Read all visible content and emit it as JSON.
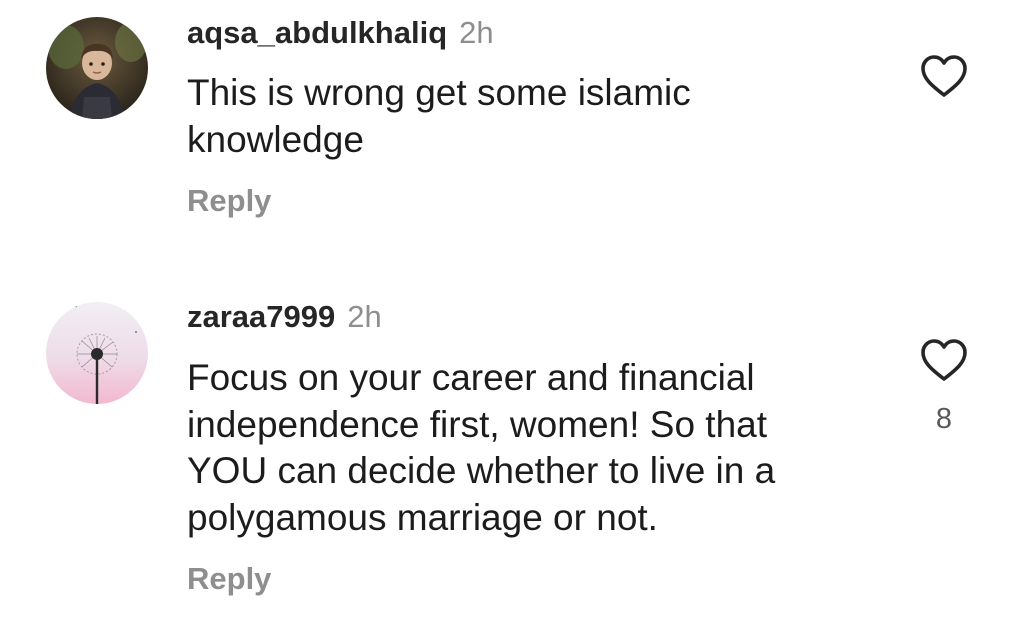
{
  "comments": [
    {
      "username": "aqsa_abdulkhaliq",
      "time": "2h",
      "text_lines": [
        "This is wrong get some islamic",
        "knowledge"
      ],
      "reply_label": "Reply",
      "avatar_icon": "child-photo-avatar",
      "like_icon": "heart-outline-icon",
      "like_count": ""
    },
    {
      "username": "zaraa7999",
      "time": "2h",
      "text_lines": [
        "Focus on your career and financial",
        "independence first, women! So that",
        "YOU can decide whether to live in a",
        "polygamous marriage or not."
      ],
      "reply_label": "Reply",
      "avatar_icon": "dandelion-avatar",
      "like_icon": "heart-outline-icon",
      "like_count": "8"
    }
  ],
  "colors": {
    "text": "#1c1c1c",
    "username": "#262626",
    "muted": "#8e8e8e",
    "icon": "#262626"
  }
}
